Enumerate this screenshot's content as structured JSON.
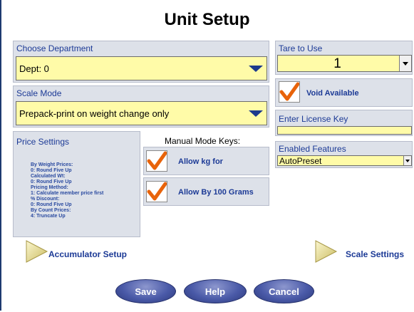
{
  "title": "Unit Setup",
  "department": {
    "label": "Choose Department",
    "value": "Dept: 0"
  },
  "scale_mode": {
    "label": "Scale Mode",
    "value": "Prepack-print on weight change only"
  },
  "tare": {
    "label": "Tare to Use",
    "value": "1"
  },
  "void": {
    "label": "Void Available",
    "checked": true
  },
  "license": {
    "label": "Enter License Key",
    "value": ""
  },
  "features": {
    "label": "Enabled Features",
    "value": "AutoPreset"
  },
  "price_settings": {
    "label": "Price Settings",
    "lines": [
      "By Weight Prices:",
      "0: Round Five Up",
      "Calculated Wt:",
      "0: Round Five Up",
      "Pricing Method:",
      "1: Calculate member price first",
      "% Discount:",
      "0: Round Five Up",
      "By Count Prices:",
      "4: Truncate Up"
    ]
  },
  "manual_mode": {
    "title": "Manual Mode Keys:",
    "allow_kg": "Allow kg for",
    "allow_100g": "Allow By 100 Grams"
  },
  "nav": {
    "accumulator": "Accumulator Setup",
    "scale": "Scale Settings"
  },
  "buttons": {
    "save": "Save",
    "help": "Help",
    "cancel": "Cancel"
  },
  "colors": {
    "panel": "#dde1e9",
    "field": "#fffba8",
    "label": "#1c3a96",
    "check": "#e8630a"
  },
  "icons": {
    "dropdown": "triangle-down-icon",
    "check": "checkmark-icon",
    "nav": "arrow-right-icon"
  }
}
